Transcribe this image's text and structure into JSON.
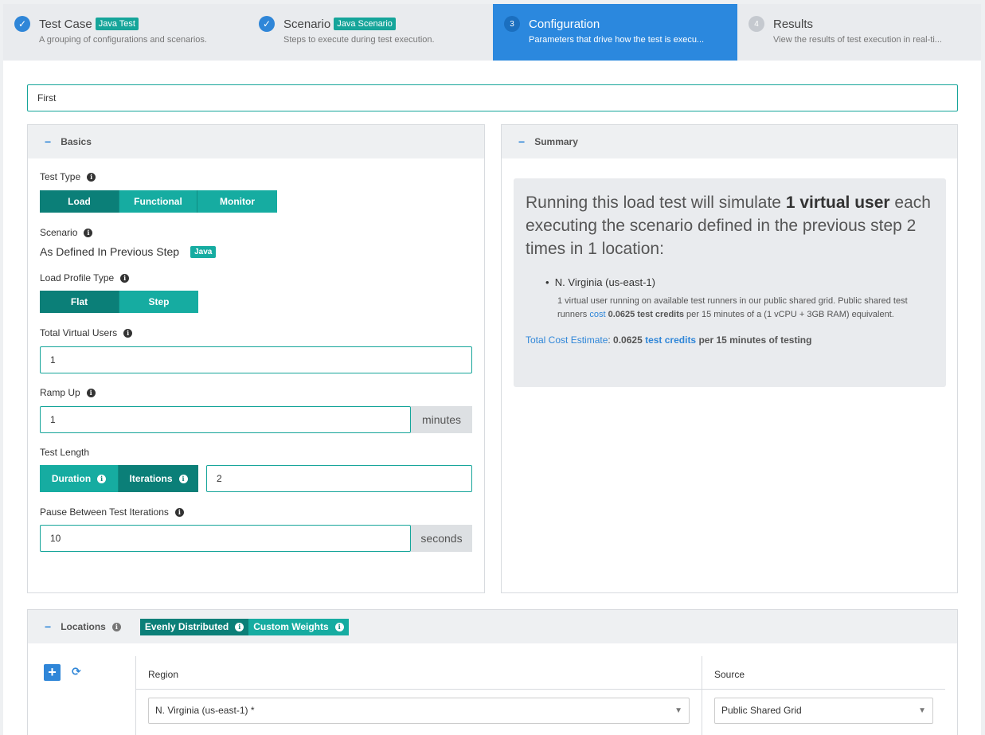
{
  "steps": [
    {
      "title": "Test Case",
      "badge": "Java Test",
      "sub": "A grouping of configurations and scenarios."
    },
    {
      "title": "Scenario",
      "badge": "Java Scenario",
      "sub": "Steps to execute during test execution."
    },
    {
      "num": "3",
      "title": "Configuration",
      "sub": "Parameters that drive how the test is execu..."
    },
    {
      "num": "4",
      "title": "Results",
      "sub": "View the results of test execution in real-ti..."
    }
  ],
  "config_name": "First",
  "basics": {
    "title": "Basics",
    "test_type_label": "Test Type",
    "test_types": [
      "Load",
      "Functional",
      "Monitor"
    ],
    "scenario_label": "Scenario",
    "scenario_value": "As Defined In Previous Step",
    "scenario_badge": "Java",
    "load_profile_label": "Load Profile Type",
    "load_profiles": [
      "Flat",
      "Step"
    ],
    "total_users_label": "Total Virtual Users",
    "total_users_value": "1",
    "ramp_up_label": "Ramp Up",
    "ramp_up_value": "1",
    "ramp_up_unit": "minutes",
    "test_length_label": "Test Length",
    "duration_label": "Duration",
    "iterations_label": "Iterations",
    "iterations_value": "2",
    "pause_label": "Pause Between Test Iterations",
    "pause_value": "10",
    "pause_unit": "seconds"
  },
  "summary": {
    "title": "Summary",
    "line_pre": "Running this load test will simulate ",
    "line_bold": "1 virtual user",
    "line_post": " each executing the scenario defined in the previous step 2 times in 1 location:",
    "location": "N. Virginia (us-east-1)",
    "desc_pre": "1 virtual user running on available test runners in our public shared grid. Public shared test runners ",
    "desc_link": "cost",
    "desc_bold": " 0.0625 test credits",
    "desc_post": " per 15 minutes of a (1 vCPU + 3GB RAM) equivalent.",
    "total_label": "Total Cost Estimate",
    "total_colon": ": ",
    "total_value": "0.0625",
    "total_link": " test credits",
    "total_post": " per 15 minutes of testing"
  },
  "locations": {
    "title": "Locations",
    "evenly": "Evenly Distributed",
    "custom": "Custom Weights",
    "col_region": "Region",
    "col_source": "Source",
    "region_value": "N. Virginia (us-east-1) *",
    "source_value": "Public Shared Grid"
  }
}
